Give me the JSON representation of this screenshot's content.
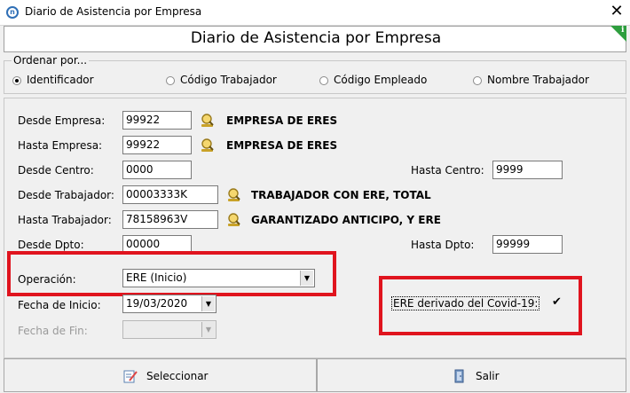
{
  "window": {
    "title": "Diario de Asistencia por Empresa",
    "close_glyph": "✕"
  },
  "header": {
    "title": "Diario de Asistencia por Empresa",
    "info_glyph": "i"
  },
  "sort": {
    "legend": "Ordenar por...",
    "options": [
      {
        "label": "Identificador",
        "selected": true
      },
      {
        "label": "Código Trabajador",
        "selected": false
      },
      {
        "label": "Código Empleado",
        "selected": false
      },
      {
        "label": "Nombre Trabajador",
        "selected": false
      }
    ]
  },
  "form": {
    "desde_empresa": {
      "label": "Desde Empresa:",
      "value": "99922",
      "desc": "EMPRESA DE ERES"
    },
    "hasta_empresa": {
      "label": "Hasta Empresa:",
      "value": "99922",
      "desc": "EMPRESA DE ERES"
    },
    "desde_centro": {
      "label": "Desde Centro:",
      "value": "0000"
    },
    "hasta_centro": {
      "label": "Hasta Centro:",
      "value": "9999"
    },
    "desde_trabajador": {
      "label": "Desde Trabajador:",
      "value": "00003333K",
      "desc": "TRABAJADOR CON ERE, TOTAL"
    },
    "hasta_trabajador": {
      "label": "Hasta Trabajador:",
      "value": "78158963V",
      "desc": "GARANTIZADO ANTICIPO, Y ERE"
    },
    "desde_dpto": {
      "label": "Desde Dpto:",
      "value": "00000"
    },
    "hasta_dpto": {
      "label": "Hasta Dpto:",
      "value": "99999"
    },
    "operacion": {
      "label": "Operación:",
      "value": "ERE (Inicio)"
    },
    "fecha_inicio": {
      "label": "Fecha de Inicio:",
      "value": "19/03/2020"
    },
    "fecha_fin": {
      "label": "Fecha de Fin:",
      "value": ""
    },
    "covid": {
      "label": "ERE derivado del Covid-19:",
      "checked": true,
      "check_glyph": "✔"
    }
  },
  "buttons": {
    "select_label": "Seleccionar",
    "exit_label": "Salir"
  },
  "colors": {
    "highlight": "#e0141e",
    "info_badge": "#2e9e3e",
    "app_icon": "#2f6fb6"
  }
}
